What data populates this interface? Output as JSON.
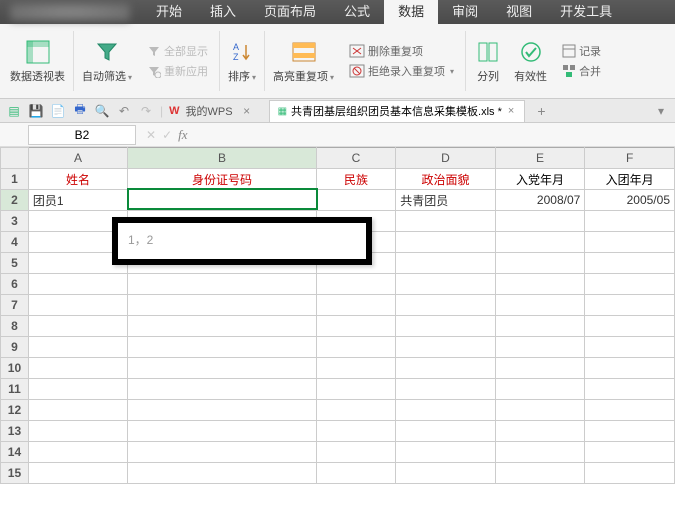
{
  "tabs": {
    "start": "开始",
    "insert": "插入",
    "layout": "页面布局",
    "formula": "公式",
    "data": "数据",
    "review": "审阅",
    "view": "视图",
    "dev": "开发工具"
  },
  "ribbon": {
    "pivot": "数据透视表",
    "autofilter": "自动筛选",
    "showall": "全部显示",
    "reapply": "重新应用",
    "sort": "排序",
    "highlight_dup": "高亮重复项",
    "remove_dup": "删除重复项",
    "reject_dup": "拒绝录入重复项",
    "texttocols": "分列",
    "validation": "有效性",
    "record": "记录",
    "consolidate": "合并"
  },
  "wps": {
    "label": "我的WPS"
  },
  "doc": {
    "name": "共青团基层组织团员基本信息采集模板.xls *"
  },
  "namebox": {
    "value": "B2"
  },
  "cols": {
    "A": "A",
    "B": "B",
    "C": "C",
    "D": "D",
    "E": "E",
    "F": "F"
  },
  "headers": {
    "name": "姓名",
    "idnum": "身份证号码",
    "ethnic": "民族",
    "political": "政治面貌",
    "party_date": "入党年月",
    "league_date": "入团年月"
  },
  "rowdata": {
    "r2": {
      "name": "团员1",
      "political": "共青团员",
      "party_date": "2008/07",
      "league_date": "2005/05"
    }
  },
  "tooltip": {
    "text": "1，2"
  }
}
